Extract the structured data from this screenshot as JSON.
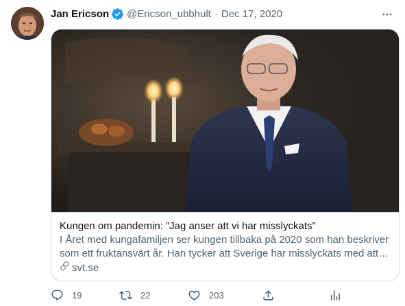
{
  "tweet": {
    "author_name": "Jan Ericson",
    "handle": "@Ericson_ubbhult",
    "separator": "·",
    "date": "Dec 17, 2020"
  },
  "card": {
    "title": "Kungen om pandemin: ”Jag anser att vi har misslyckats”",
    "description": "I Året med kungafamiljen ser kungen tillbaka på 2020 som han beskriver som ett fruktansvärt år. Han tycker att Sverige har misslyckats med att …",
    "domain": "svt.se"
  },
  "actions": {
    "replies": "19",
    "retweets": "22",
    "likes": "203"
  },
  "icons": {
    "verified": "verified-badge-icon",
    "more": "more-options-icon",
    "link": "link-icon",
    "reply": "reply-icon",
    "retweet": "retweet-icon",
    "like": "heart-icon",
    "share": "share-icon",
    "analytics": "analytics-icon"
  },
  "colors": {
    "text_primary": "#0f1419",
    "text_secondary": "#536471",
    "verified_blue": "#1d9bf0",
    "border": "#cfd9de"
  }
}
